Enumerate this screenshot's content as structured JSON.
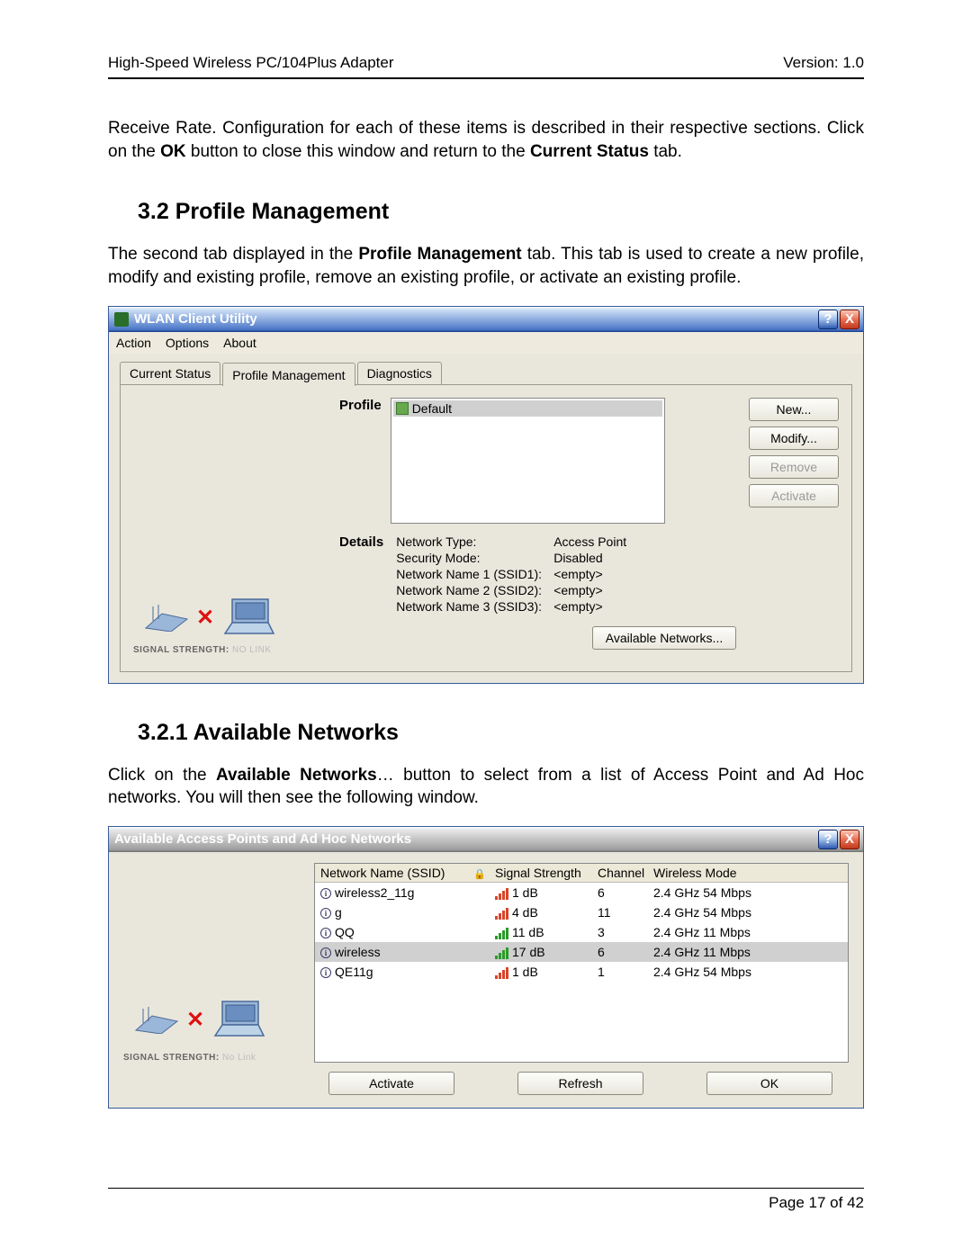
{
  "header": {
    "left": "High-Speed Wireless PC/104Plus Adapter",
    "right": "Version: 1.0"
  },
  "para1_pre": "Receive Rate. Configuration for each of these items is described in their respective sections.  Click on the ",
  "para1_b1": "OK",
  "para1_mid": " button to close this window and return to the ",
  "para1_b2": "Current Status",
  "para1_post": " tab.",
  "heading32": "3.2  Profile Management",
  "para2_pre": "The second tab displayed in the ",
  "para2_b1": "Profile Management",
  "para2_post": " tab.  This tab is used to create a new profile, modify and existing profile, remove an existing profile, or activate an existing profile.",
  "win1": {
    "title": "WLAN Client Utility",
    "menu": {
      "m0": "Action",
      "m1": "Options",
      "m2": "About"
    },
    "tabs": {
      "t0": "Current Status",
      "t1": "Profile Management",
      "t2": "Diagnostics"
    },
    "section_profile": "Profile",
    "profile_entry": "Default",
    "buttons": {
      "new": "New...",
      "modify": "Modify...",
      "remove": "Remove",
      "activate": "Activate"
    },
    "section_details": "Details",
    "details": {
      "l0": "Network Type:",
      "v0": "Access Point",
      "l1": "Security Mode:",
      "v1": "Disabled",
      "l2": "Network Name 1 (SSID1):",
      "v2": "<empty>",
      "l3": "Network Name 2 (SSID2):",
      "v3": "<empty>",
      "l4": "Network Name 3 (SSID3):",
      "v4": "<empty>"
    },
    "avail_btn": "Available Networks...",
    "signal_label": "SIGNAL STRENGTH: ",
    "signal_status": "NO LINK"
  },
  "heading321": "3.2.1 Available Networks",
  "para3_pre": "Click on the ",
  "para3_b1": "Available Networks",
  "para3_post": "… button to select from a list of Access Point and Ad Hoc networks.  You will then see the following window.",
  "win2": {
    "title": "Available Access Points and Ad Hoc Networks",
    "columns": {
      "c0": "Network Name (SSID)",
      "c1": "",
      "c2": "Signal Strength",
      "c3": "Channel",
      "c4": "Wireless Mode"
    },
    "rows": [
      {
        "ssid": "wireless2_11g",
        "sig": "1 dB",
        "ch": "6",
        "mode": "2.4 GHz 54 Mbps",
        "selected": false,
        "weak": true
      },
      {
        "ssid": "g",
        "sig": "4 dB",
        "ch": "11",
        "mode": "2.4 GHz 54 Mbps",
        "selected": false,
        "weak": true
      },
      {
        "ssid": "QQ",
        "sig": "11 dB",
        "ch": "3",
        "mode": "2.4 GHz 11 Mbps",
        "selected": false,
        "weak": false
      },
      {
        "ssid": "wireless",
        "sig": "17 dB",
        "ch": "6",
        "mode": "2.4 GHz 11 Mbps",
        "selected": true,
        "weak": false
      },
      {
        "ssid": "QE11g",
        "sig": "1 dB",
        "ch": "1",
        "mode": "2.4 GHz 54 Mbps",
        "selected": false,
        "weak": true
      }
    ],
    "signal_label": "SIGNAL STRENGTH: ",
    "signal_status": "No Link",
    "buttons": {
      "activate": "Activate",
      "refresh": "Refresh",
      "ok": "OK"
    }
  },
  "footer": "Page 17 of 42",
  "icons": {
    "help": "?",
    "close": "X",
    "lock": "🔒",
    "key": "⚿"
  }
}
